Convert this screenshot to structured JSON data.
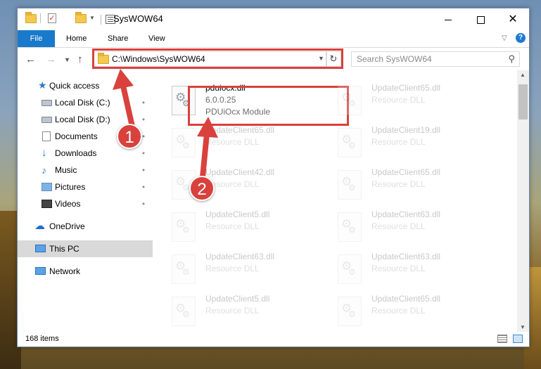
{
  "window": {
    "title": "SysWOW64",
    "close_glyph": "✕"
  },
  "ribbon": {
    "tabs": [
      "File",
      "Home",
      "Share",
      "View"
    ],
    "help": "?"
  },
  "nav": {
    "address": "C:\\Windows\\SysWOW64",
    "search_placeholder": "Search SysWOW64"
  },
  "sidebar": {
    "items": [
      {
        "label": "Quick access",
        "icon": "star-icon",
        "pinned": false
      },
      {
        "label": "Local Disk (C:)",
        "icon": "disk-icon",
        "pinned": true
      },
      {
        "label": "Local Disk (D:)",
        "icon": "disk-icon",
        "pinned": true
      },
      {
        "label": "Documents",
        "icon": "documents-icon",
        "pinned": true
      },
      {
        "label": "Downloads",
        "icon": "download-icon",
        "pinned": true
      },
      {
        "label": "Music",
        "icon": "music-icon",
        "pinned": true
      },
      {
        "label": "Pictures",
        "icon": "pictures-icon",
        "pinned": true
      },
      {
        "label": "Videos",
        "icon": "videos-icon",
        "pinned": true
      },
      {
        "label": "OneDrive",
        "icon": "cloud-icon",
        "pinned": false
      },
      {
        "label": "This PC",
        "icon": "computer-icon",
        "pinned": false,
        "selected": true
      },
      {
        "label": "Network",
        "icon": "network-icon",
        "pinned": false
      }
    ],
    "pin_glyph": "📌"
  },
  "files": {
    "highlighted": {
      "name": "pduiocx.dll",
      "version": "6.0.0.25",
      "description": "PDUiOcx Module"
    },
    "faded": [
      {
        "name": "UpdateClient65.dll",
        "type": "Resource DLL"
      },
      {
        "name": "UpdateClient65.dll",
        "type": "Resource DLL"
      },
      {
        "name": "UpdateClient19.dll",
        "type": "Resource DLL"
      },
      {
        "name": "UpdateClient42.dll",
        "type": "Resource DLL"
      },
      {
        "name": "UpdateClient65.dll",
        "type": "Resource DLL"
      },
      {
        "name": "UpdateClient5.dll",
        "type": "Resource DLL"
      },
      {
        "name": "UpdateClient63.dll",
        "type": "Resource DLL"
      },
      {
        "name": "UpdateClient63.dll",
        "type": "Resource DLL"
      },
      {
        "name": "UpdateClient63.dll",
        "type": "Resource DLL"
      },
      {
        "name": "UpdateClient5.dll",
        "type": "Resource DLL"
      },
      {
        "name": "UpdateClient65.dll",
        "type": "Resource DLL"
      }
    ]
  },
  "status": {
    "item_count": "168 items"
  },
  "callouts": [
    "1",
    "2"
  ],
  "colors": {
    "accent": "#1979ca",
    "highlight": "#d9413d"
  }
}
